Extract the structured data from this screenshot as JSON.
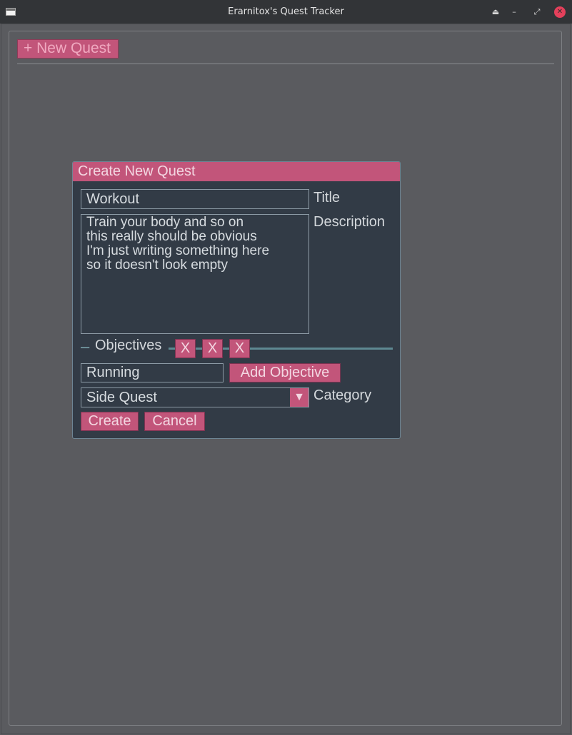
{
  "window": {
    "title": "Erarnitox's Quest Tracker",
    "icons": [
      "app-window-icon",
      "keep-above-icon",
      "minimize-icon",
      "maximize-icon",
      "close-icon"
    ],
    "controls": {
      "keep_above": "⏏",
      "minimize": "–",
      "maximize": "⤢",
      "close": "✕"
    }
  },
  "toolbar": {
    "new_quest_label": "+ New Quest"
  },
  "dialog": {
    "title": "Create New Quest",
    "title_field": {
      "value": "Workout",
      "label": "Title"
    },
    "description_field": {
      "value": "Train your body and so on\nthis really should be obvious\nI'm just writing something here\nso it doesn't look empty",
      "label": "Description"
    },
    "objectives": {
      "collapse_glyph": "–",
      "label": "Objectives",
      "remove_buttons": [
        "X",
        "X",
        "X"
      ]
    },
    "objective_input": {
      "value": "Running"
    },
    "add_objective_label": "Add Objective",
    "category": {
      "selected": "Side Quest",
      "label": "Category",
      "arrow": "▼"
    },
    "create_label": "Create",
    "cancel_label": "Cancel"
  },
  "colors": {
    "accent": "#c2557a",
    "background": "#5a5b5f",
    "dialog_bg": "#323b46",
    "titlebar_bg": "#323437",
    "close_button": "#e4405b"
  }
}
